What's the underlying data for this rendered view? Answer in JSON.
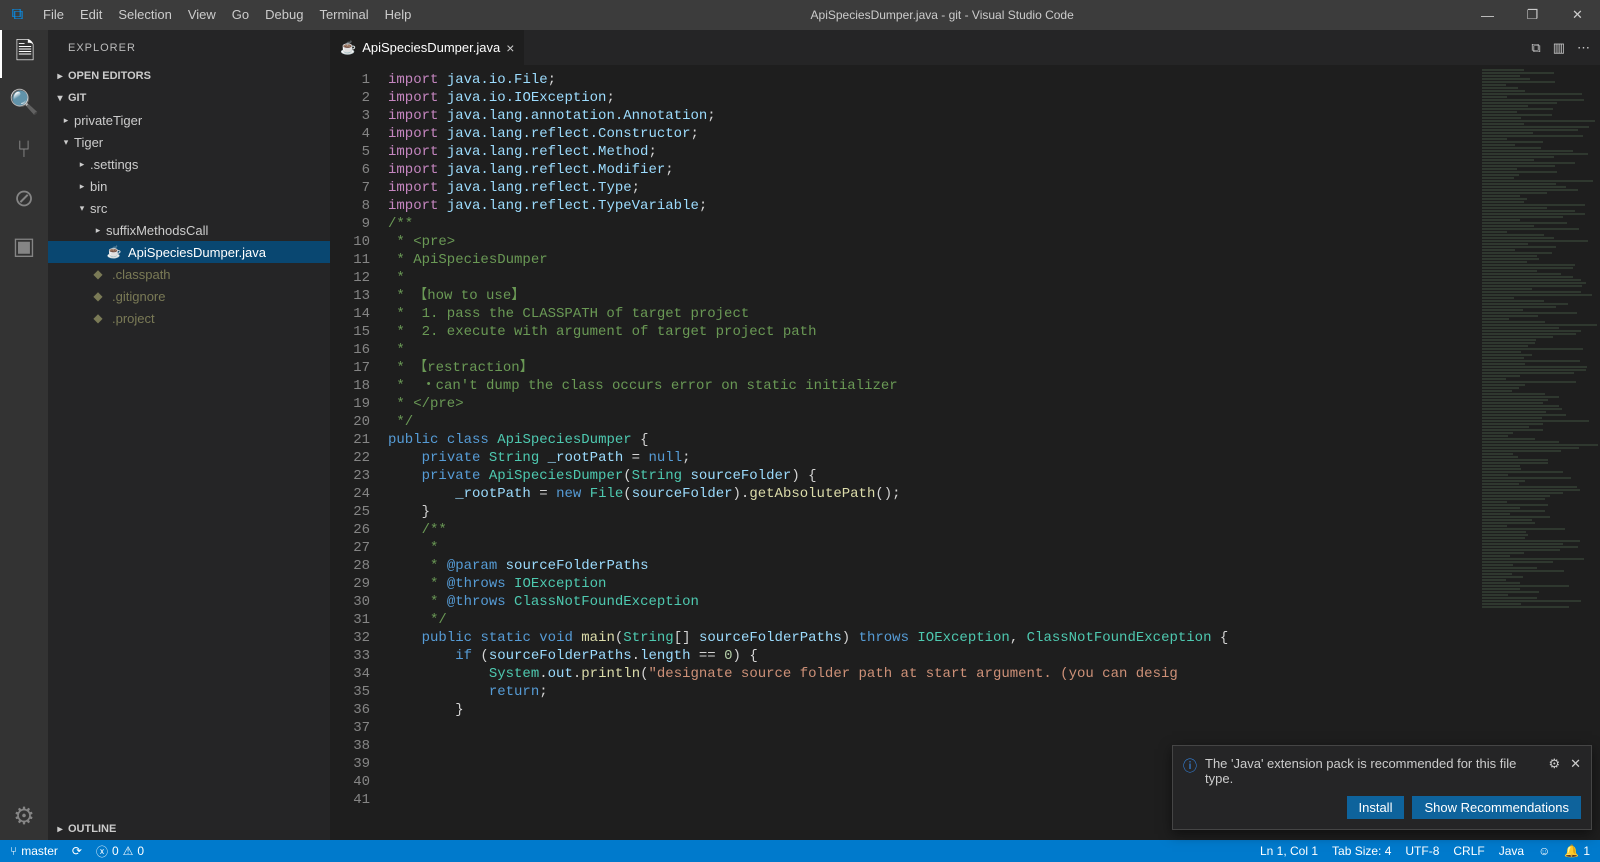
{
  "titlebar": {
    "title": "ApiSpeciesDumper.java - git - Visual Studio Code",
    "menu": [
      "File",
      "Edit",
      "Selection",
      "View",
      "Go",
      "Debug",
      "Terminal",
      "Help"
    ]
  },
  "sidebar": {
    "header": "EXPLORER",
    "sections": {
      "open_editors": "OPEN EDITORS",
      "repo": "GIT",
      "outline": "OUTLINE"
    },
    "tree": [
      {
        "indent": 12,
        "tw": "▸",
        "label": "privateTiger"
      },
      {
        "indent": 12,
        "tw": "▾",
        "label": "Tiger"
      },
      {
        "indent": 28,
        "tw": "▸",
        "label": ".settings"
      },
      {
        "indent": 28,
        "tw": "▸",
        "label": "bin"
      },
      {
        "indent": 28,
        "tw": "▾",
        "label": "src"
      },
      {
        "indent": 44,
        "tw": "▸",
        "label": "suffixMethodsCall"
      },
      {
        "indent": 44,
        "tw": "",
        "ico": "☕",
        "label": "ApiSpeciesDumper.java",
        "selected": true
      },
      {
        "indent": 28,
        "tw": "",
        "ico": "◆",
        "label": ".classpath",
        "dim": true
      },
      {
        "indent": 28,
        "tw": "",
        "ico": "◆",
        "label": ".gitignore",
        "dim": true
      },
      {
        "indent": 28,
        "tw": "",
        "ico": "◆",
        "label": ".project",
        "dim": true
      }
    ]
  },
  "tab": {
    "label": "ApiSpeciesDumper.java"
  },
  "code": {
    "lines": 41,
    "src": [
      [
        [
          "k-import",
          "import"
        ],
        [
          "",
          " "
        ],
        [
          "k-pkg",
          "java.io.File"
        ],
        [
          "",
          ";"
        ]
      ],
      [
        [
          "k-import",
          "import"
        ],
        [
          "",
          " "
        ],
        [
          "k-pkg",
          "java.io.IOException"
        ],
        [
          "",
          ";"
        ]
      ],
      [
        [
          "k-import",
          "import"
        ],
        [
          "",
          " "
        ],
        [
          "k-pkg",
          "java.lang.annotation.Annotation"
        ],
        [
          "",
          ";"
        ]
      ],
      [
        [
          "k-import",
          "import"
        ],
        [
          "",
          " "
        ],
        [
          "k-pkg",
          "java.lang.reflect.Constructor"
        ],
        [
          "",
          ";"
        ]
      ],
      [
        [
          "k-import",
          "import"
        ],
        [
          "",
          " "
        ],
        [
          "k-pkg",
          "java.lang.reflect.Method"
        ],
        [
          "",
          ";"
        ]
      ],
      [
        [
          "k-import",
          "import"
        ],
        [
          "",
          " "
        ],
        [
          "k-pkg",
          "java.lang.reflect.Modifier"
        ],
        [
          "",
          ";"
        ]
      ],
      [
        [
          "k-import",
          "import"
        ],
        [
          "",
          " "
        ],
        [
          "k-pkg",
          "java.lang.reflect.Type"
        ],
        [
          "",
          ";"
        ]
      ],
      [
        [
          "k-import",
          "import"
        ],
        [
          "",
          " "
        ],
        [
          "k-pkg",
          "java.lang.reflect.TypeVariable"
        ],
        [
          "",
          ";"
        ]
      ],
      [
        [
          "",
          ""
        ]
      ],
      [
        [
          "k-doc",
          "/**"
        ]
      ],
      [
        [
          "k-doc",
          " * <pre>"
        ]
      ],
      [
        [
          "k-doc",
          " * ApiSpeciesDumper"
        ]
      ],
      [
        [
          "k-doc",
          " *"
        ]
      ],
      [
        [
          "k-doc",
          " * 【how to use】"
        ]
      ],
      [
        [
          "k-doc",
          " *  1. pass the CLASSPATH of target project"
        ]
      ],
      [
        [
          "k-doc",
          " *  2. execute with argument of target project path"
        ]
      ],
      [
        [
          "k-doc",
          " *"
        ]
      ],
      [
        [
          "k-doc",
          " * 【restraction】"
        ]
      ],
      [
        [
          "k-doc",
          " *  ・can't dump the class occurs error on static initializer"
        ]
      ],
      [
        [
          "k-doc",
          " * </pre>"
        ]
      ],
      [
        [
          "k-doc",
          " */"
        ]
      ],
      [
        [
          "k-kw",
          "public"
        ],
        [
          "",
          " "
        ],
        [
          "k-kw",
          "class"
        ],
        [
          "",
          " "
        ],
        [
          "k-type",
          "ApiSpeciesDumper"
        ],
        [
          "",
          " {"
        ]
      ],
      [
        [
          "",
          ""
        ]
      ],
      [
        [
          "",
          "    "
        ],
        [
          "k-kw",
          "private"
        ],
        [
          "",
          " "
        ],
        [
          "k-type",
          "String"
        ],
        [
          "",
          " "
        ],
        [
          "k-var",
          "_rootPath"
        ],
        [
          "",
          " = "
        ],
        [
          "k-kw",
          "null"
        ],
        [
          "",
          ";"
        ]
      ],
      [
        [
          "",
          ""
        ]
      ],
      [
        [
          "",
          "    "
        ],
        [
          "k-kw",
          "private"
        ],
        [
          "",
          " "
        ],
        [
          "k-type",
          "ApiSpeciesDumper"
        ],
        [
          "",
          "("
        ],
        [
          "k-type",
          "String"
        ],
        [
          "",
          " "
        ],
        [
          "k-var",
          "sourceFolder"
        ],
        [
          "",
          ") {"
        ]
      ],
      [
        [
          "",
          "        "
        ],
        [
          "k-var",
          "_rootPath"
        ],
        [
          "",
          " = "
        ],
        [
          "k-kw",
          "new"
        ],
        [
          "",
          " "
        ],
        [
          "k-type",
          "File"
        ],
        [
          "",
          "("
        ],
        [
          "k-var",
          "sourceFolder"
        ],
        [
          "",
          ")."
        ],
        [
          "k-fn",
          "getAbsolutePath"
        ],
        [
          "",
          "();"
        ]
      ],
      [
        [
          "",
          "    }"
        ]
      ],
      [
        [
          "",
          ""
        ]
      ],
      [
        [
          "",
          "    "
        ],
        [
          "k-doc",
          "/**"
        ]
      ],
      [
        [
          "",
          "     "
        ],
        [
          "k-doc",
          "*"
        ]
      ],
      [
        [
          "",
          "     "
        ],
        [
          "k-doc",
          "* "
        ],
        [
          "k-tag",
          "@param"
        ],
        [
          "k-doc",
          " "
        ],
        [
          "k-var",
          "sourceFolderPaths"
        ]
      ],
      [
        [
          "",
          "     "
        ],
        [
          "k-doc",
          "* "
        ],
        [
          "k-tag",
          "@throws"
        ],
        [
          "k-doc",
          " "
        ],
        [
          "k-type",
          "IOException"
        ]
      ],
      [
        [
          "",
          "     "
        ],
        [
          "k-doc",
          "* "
        ],
        [
          "k-tag",
          "@throws"
        ],
        [
          "k-doc",
          " "
        ],
        [
          "k-type",
          "ClassNotFoundException"
        ]
      ],
      [
        [
          "",
          "     "
        ],
        [
          "k-doc",
          "*/"
        ]
      ],
      [
        [
          "",
          "    "
        ],
        [
          "k-kw",
          "public"
        ],
        [
          "",
          " "
        ],
        [
          "k-kw",
          "static"
        ],
        [
          "",
          " "
        ],
        [
          "k-kw",
          "void"
        ],
        [
          "",
          " "
        ],
        [
          "k-fn",
          "main"
        ],
        [
          "",
          "("
        ],
        [
          "k-type",
          "String"
        ],
        [
          "",
          "[] "
        ],
        [
          "k-var",
          "sourceFolderPaths"
        ],
        [
          "",
          ") "
        ],
        [
          "k-kw",
          "throws"
        ],
        [
          "",
          " "
        ],
        [
          "k-type",
          "IOException"
        ],
        [
          "",
          ", "
        ],
        [
          "k-type",
          "ClassNotFoundException"
        ],
        [
          "",
          " {"
        ]
      ],
      [
        [
          "",
          ""
        ]
      ],
      [
        [
          "",
          "        "
        ],
        [
          "k-kw",
          "if"
        ],
        [
          "",
          " ("
        ],
        [
          "k-var",
          "sourceFolderPaths"
        ],
        [
          "",
          "."
        ],
        [
          "k-var",
          "length"
        ],
        [
          "",
          " == "
        ],
        [
          "k-num",
          "0"
        ],
        [
          "",
          ") {"
        ]
      ],
      [
        [
          "",
          "            "
        ],
        [
          "k-type",
          "System"
        ],
        [
          "",
          "."
        ],
        [
          "k-var",
          "out"
        ],
        [
          "",
          "."
        ],
        [
          "k-fn",
          "println"
        ],
        [
          "",
          "("
        ],
        [
          "k-str",
          "\"designate source folder path at start argument. (you can desig"
        ]
      ],
      [
        [
          "",
          "            "
        ],
        [
          "k-kw",
          "return"
        ],
        [
          "",
          ";"
        ]
      ],
      [
        [
          "",
          "        }"
        ]
      ]
    ]
  },
  "notification": {
    "text": "The 'Java' extension pack is recommended for this file type.",
    "btn_install": "Install",
    "btn_show": "Show Recommendations"
  },
  "statusbar": {
    "branch": "master",
    "errors": "0",
    "warnings": "0",
    "ln_col": "Ln 1, Col 1",
    "tabsize": "Tab Size: 4",
    "encoding": "UTF-8",
    "eol": "CRLF",
    "lang": "Java",
    "bell": "1"
  }
}
